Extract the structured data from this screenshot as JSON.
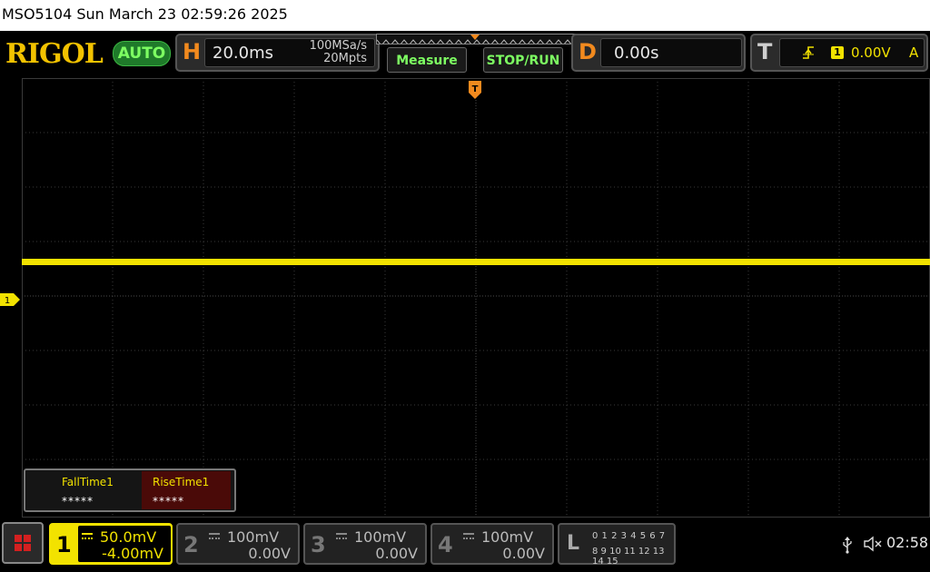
{
  "title_bar": {
    "text": "MSO5104  Sun March 23 02:59:26 2025"
  },
  "brand": {
    "logo": "RIGOL",
    "auto_label": "AUTO"
  },
  "horizontal": {
    "letter": "H",
    "timebase": "20.0ms",
    "sample_rate": "100MSa/s",
    "memory_depth": "20Mpts"
  },
  "buttons": {
    "measure": "Measure",
    "stop_run": "STOP/RUN"
  },
  "delay": {
    "letter": "D",
    "value": "0.00s"
  },
  "trigger": {
    "letter": "T",
    "edge_icon": "rising-edge-icon",
    "source_badge": "1",
    "level": "0.00V",
    "mode": "A"
  },
  "screen": {
    "ch1_marker": "1"
  },
  "measurements": [
    {
      "name": "FallTime1",
      "value": "*****"
    },
    {
      "name": "RiseTime1",
      "value": "*****"
    }
  ],
  "channels": [
    {
      "number": "1",
      "scale": "50.0mV",
      "offset": "-4.00mV",
      "active": true
    },
    {
      "number": "2",
      "scale": "100mV",
      "offset": "0.00V",
      "active": false
    },
    {
      "number": "3",
      "scale": "100mV",
      "offset": "0.00V",
      "active": false
    },
    {
      "number": "4",
      "scale": "100mV",
      "offset": "0.00V",
      "active": false
    }
  ],
  "logic_analyzer": {
    "letter": "L",
    "row1": "0 1 2 3   4 5 6 7",
    "row2": "8 9 10 11 12 13 14 15"
  },
  "status": {
    "usb_icon": "usb-icon",
    "mute_icon": "speaker-muted-icon",
    "clock": "02:58"
  },
  "colors": {
    "ch1": "#f2e200",
    "horizontal_accent": "#f28a1e",
    "buttons_text": "#7dff62",
    "logo": "#f2c200",
    "measurement_highlight": "#4a0a08",
    "menu_icon": "#d42020"
  }
}
